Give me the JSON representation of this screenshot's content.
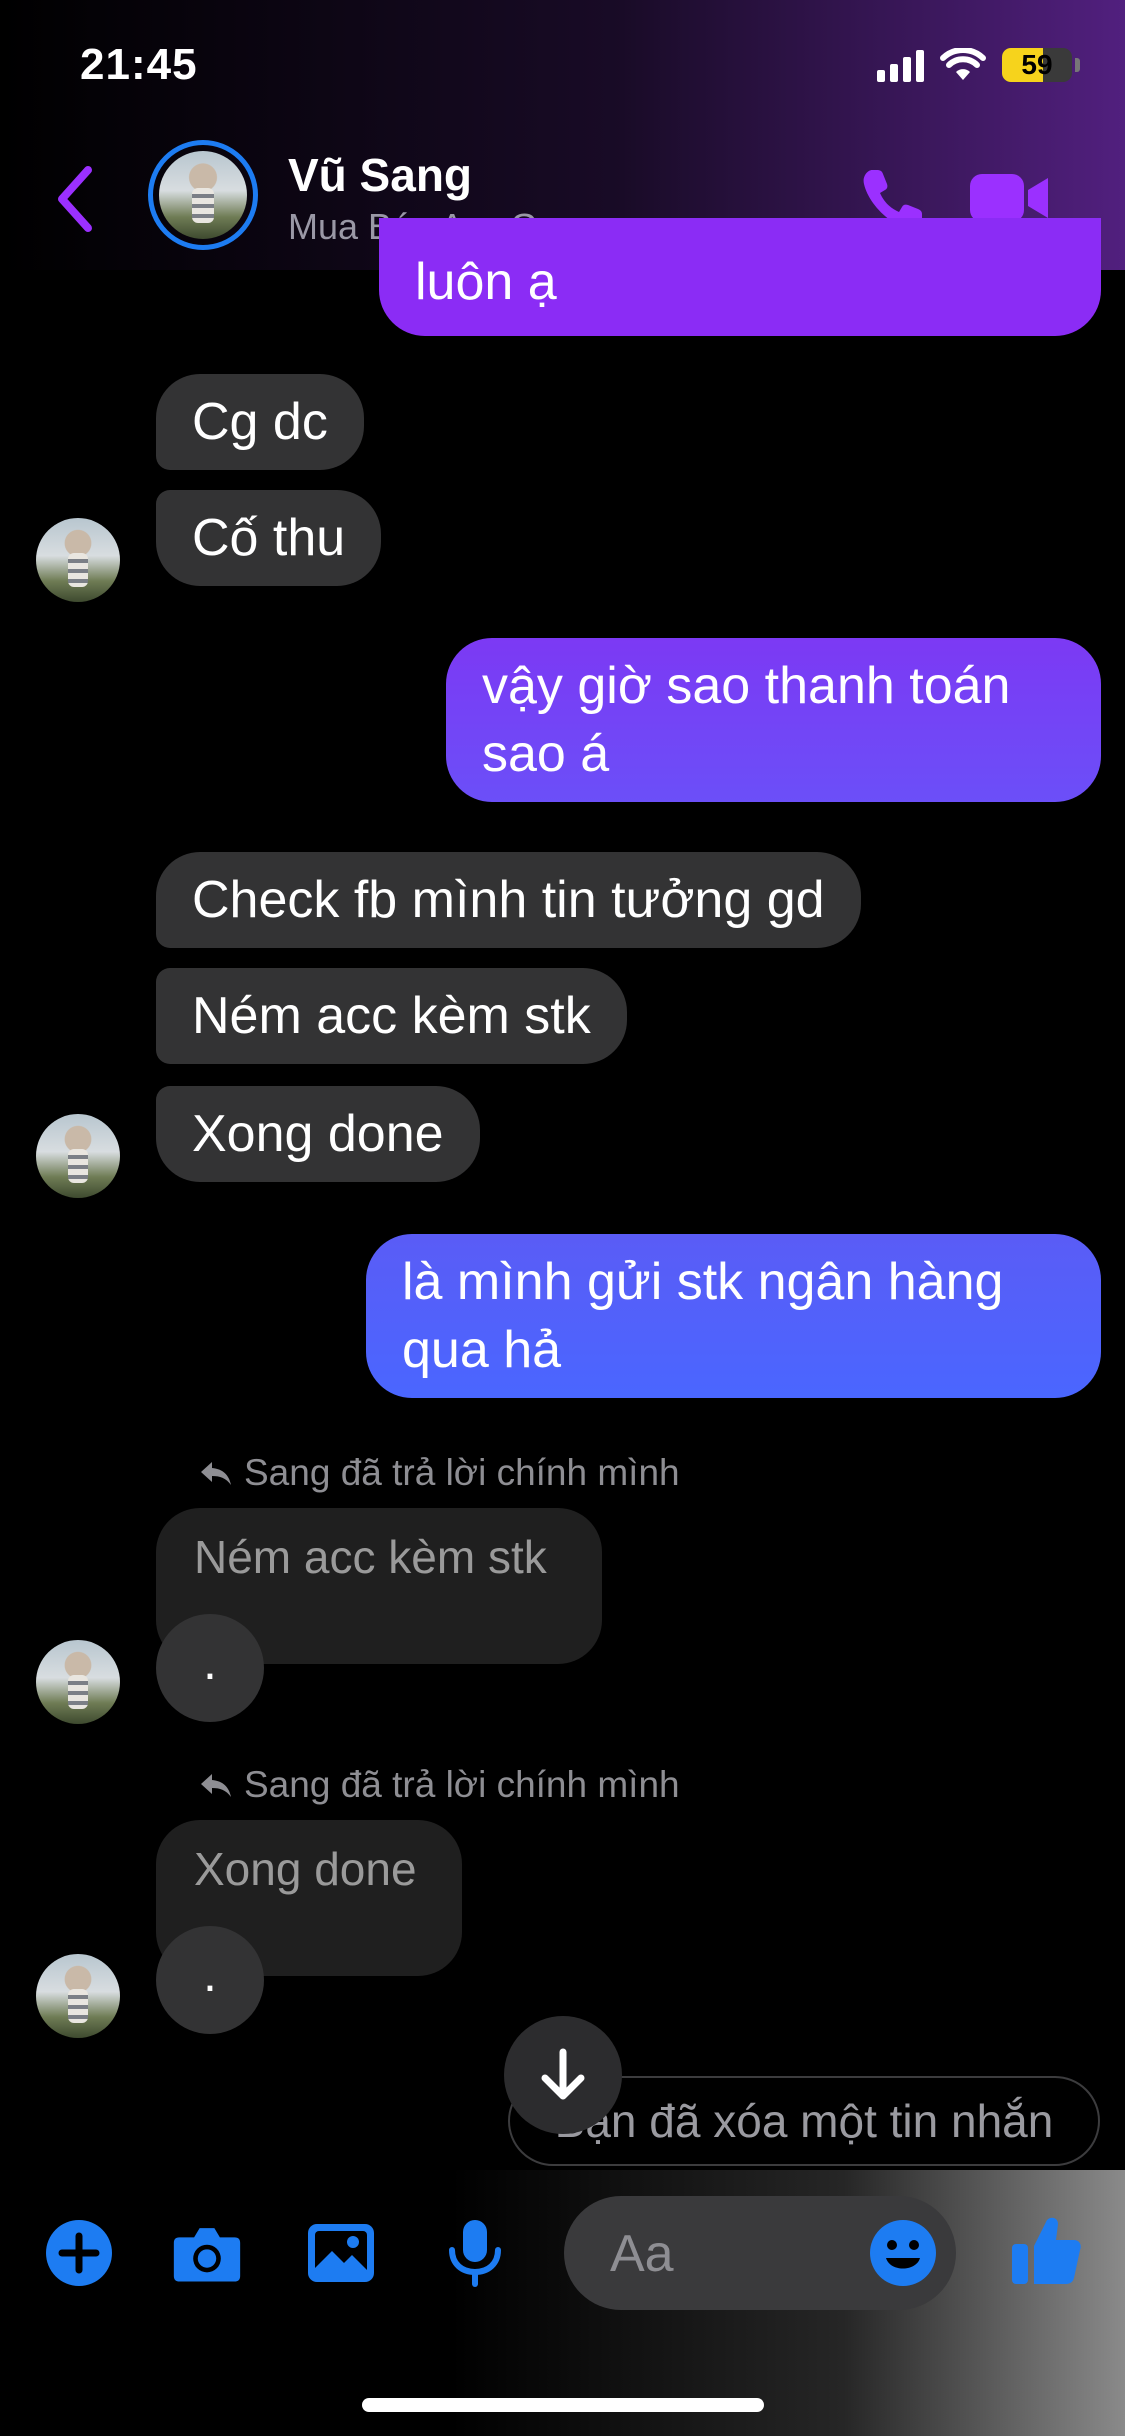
{
  "status_bar": {
    "time": "21:45",
    "battery": "59",
    "battery_level": 0.59
  },
  "header": {
    "name": "Vũ Sang",
    "subtitle": "Mua Bán Acc Game"
  },
  "messages": {
    "m0": "luôn ạ",
    "m1": "Cg dc",
    "m2": "Cố thu",
    "m3": "vậy giờ sao thanh toán sao á",
    "m4": "Check fb mình tin tưởng gd",
    "m5": "Ném acc kèm stk",
    "m6": "Xong done",
    "m7": "là mình gửi stk ngân hàng qua hả",
    "reply1_note": "Sang đã trả lời chính mình",
    "reply1_quote": "Ném acc kèm stk",
    "reply1_text": ".",
    "reply2_note": "Sang đã trả lời chính mình",
    "reply2_quote": "Xong done",
    "reply2_text": ".",
    "deleted_note": "Bạn đã xóa một tin nhắn"
  },
  "composer": {
    "placeholder": "Aa"
  },
  "colors": {
    "accent": "#7b2ff7",
    "blue": "#1d7cf2",
    "out_top": "#8a2cf4",
    "out_bottom": "#4d61ff"
  },
  "icons": [
    "back-icon",
    "phone-icon",
    "video-icon",
    "reply-arrow-icon",
    "arrow-down-icon",
    "plus-icon",
    "camera-icon",
    "image-icon",
    "mic-icon",
    "emoji-icon",
    "thumbs-up-icon"
  ]
}
